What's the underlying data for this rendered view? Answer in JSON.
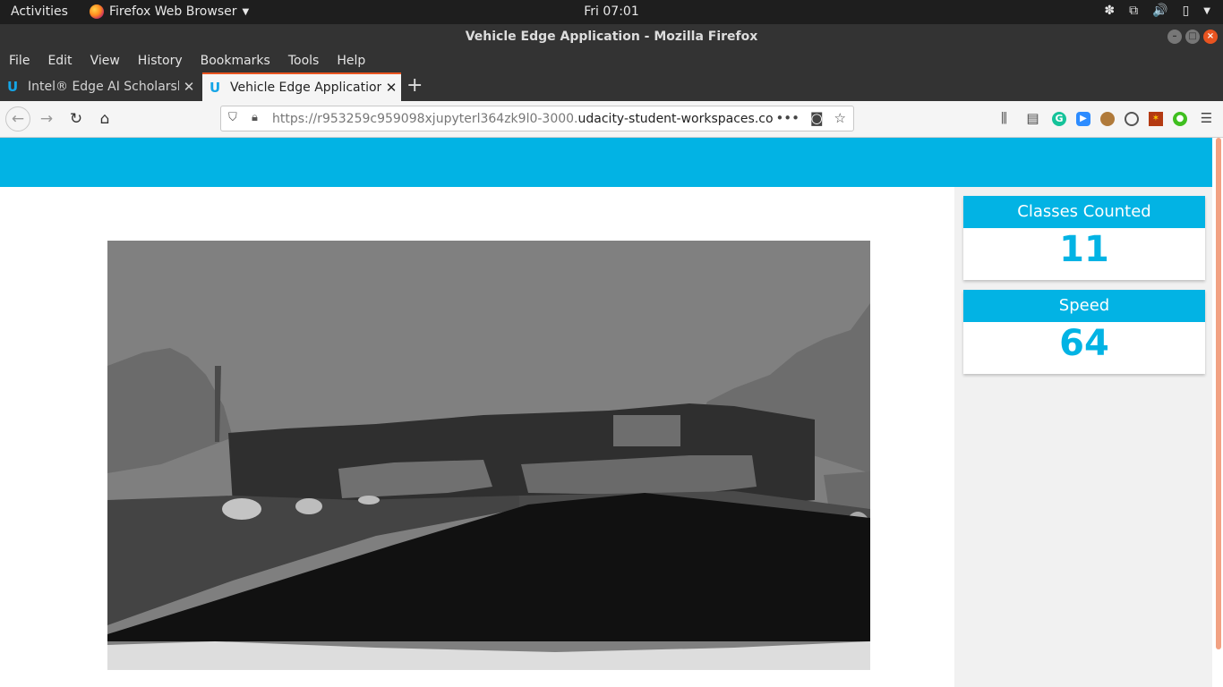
{
  "topbar": {
    "activities": "Activities",
    "app_name": "Firefox Web Browser",
    "clock": "Fri 07:01"
  },
  "window": {
    "title": "Vehicle Edge Application - Mozilla Firefox"
  },
  "menu": [
    "File",
    "Edit",
    "View",
    "History",
    "Bookmarks",
    "Tools",
    "Help"
  ],
  "tabs": [
    {
      "title": "Intel® Edge AI Scholarsh",
      "active": false
    },
    {
      "title": "Vehicle Edge Application",
      "active": true
    }
  ],
  "urlbar": {
    "url_prefix": "https://r953259c959098xjupyterl364zk9l0-3000.",
    "url_domain": "udacity-student-workspaces.com"
  },
  "page": {
    "stats": [
      {
        "label": "Classes Counted",
        "value": "11"
      },
      {
        "label": "Speed",
        "value": "64"
      }
    ]
  },
  "colors": {
    "accent": "#02b3e4",
    "firefox_accent": "#e95420",
    "scrollbar": "#f2a182"
  }
}
